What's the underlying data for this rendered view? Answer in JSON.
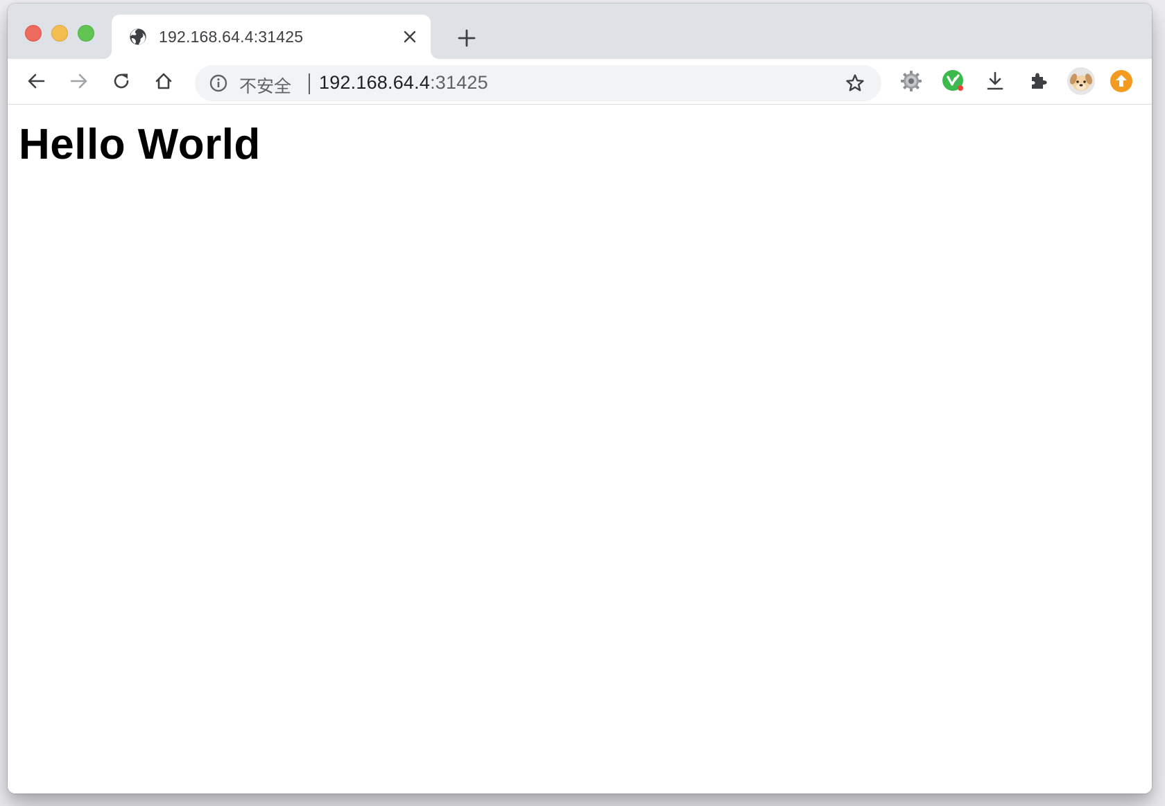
{
  "tab": {
    "title": "192.168.64.4:31425"
  },
  "omnibox": {
    "security_label": "不安全",
    "url_host": "192.168.64.4",
    "url_port": ":31425"
  },
  "page": {
    "heading": "Hello World"
  },
  "icons": {
    "favicon": "globe-icon",
    "tab_close": "close-icon",
    "new_tab": "plus-icon",
    "back": "arrow-left-icon",
    "forward": "arrow-right-icon",
    "reload": "reload-icon",
    "home": "home-icon",
    "info": "info-icon",
    "bookmark": "star-icon",
    "ext1": "gear-extension-icon",
    "ext2": "green-v-extension-icon",
    "download": "download-icon",
    "extensions": "puzzle-icon",
    "profile": "dog-avatar-icon",
    "update": "update-arrow-icon"
  },
  "colors": {
    "traffic_red": "#ed6a5e",
    "traffic_yellow": "#f5bf4f",
    "traffic_green": "#61c554",
    "tabstrip_bg": "#dee1e6",
    "omnibox_bg": "#f1f3f4",
    "update_orange": "#f29b20",
    "ext_green": "#3dba4e"
  }
}
